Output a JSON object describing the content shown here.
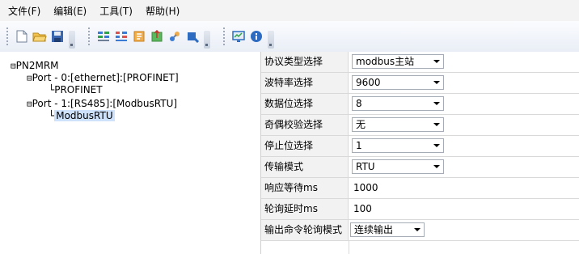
{
  "menu": [
    {
      "label": "文件(F)"
    },
    {
      "label": "编辑(E)"
    },
    {
      "label": "工具(T)"
    },
    {
      "label": "帮助(H)"
    }
  ],
  "toolbar": {
    "group1": [
      "new-file-icon",
      "open-folder-icon",
      "save-icon"
    ],
    "group2": [
      "port-config-icon",
      "tree-config-icon",
      "import-icon",
      "export-icon",
      "tools-icon",
      "download-icon"
    ],
    "group3": [
      "monitor-icon",
      "info-icon"
    ]
  },
  "tree": {
    "root": {
      "expander": "⊟",
      "label": "PN2MRM"
    },
    "port0": {
      "expander": "⊟",
      "label": "Port - 0:[ethernet]:[PROFINET]"
    },
    "port0_child": {
      "connector": "└",
      "label": "PROFINET"
    },
    "port1": {
      "expander": "⊟",
      "label": "Port - 1:[RS485]:[ModbusRTU]"
    },
    "port1_child": {
      "connector": "└",
      "label": "ModbusRTU"
    }
  },
  "properties": [
    {
      "label": "协议类型选择",
      "value": "modbus主站",
      "type": "dropdown"
    },
    {
      "label": "波特率选择",
      "value": "9600",
      "type": "dropdown"
    },
    {
      "label": "数据位选择",
      "value": "8",
      "type": "dropdown"
    },
    {
      "label": "奇偶校验选择",
      "value": "无",
      "type": "dropdown"
    },
    {
      "label": "停止位选择",
      "value": "1",
      "type": "dropdown"
    },
    {
      "label": "传输模式",
      "value": "RTU",
      "type": "dropdown"
    },
    {
      "label": "响应等待ms",
      "value": "1000",
      "type": "text"
    },
    {
      "label": "轮询延时ms",
      "value": "100",
      "type": "text"
    },
    {
      "label": "输出命令轮询模式",
      "value": "连续输出",
      "type": "dropdown"
    }
  ],
  "colors": {
    "selection": "#cfe2fb",
    "label_bg": "#f2f2f2",
    "toolbar_blue": "#2d6cc0"
  }
}
